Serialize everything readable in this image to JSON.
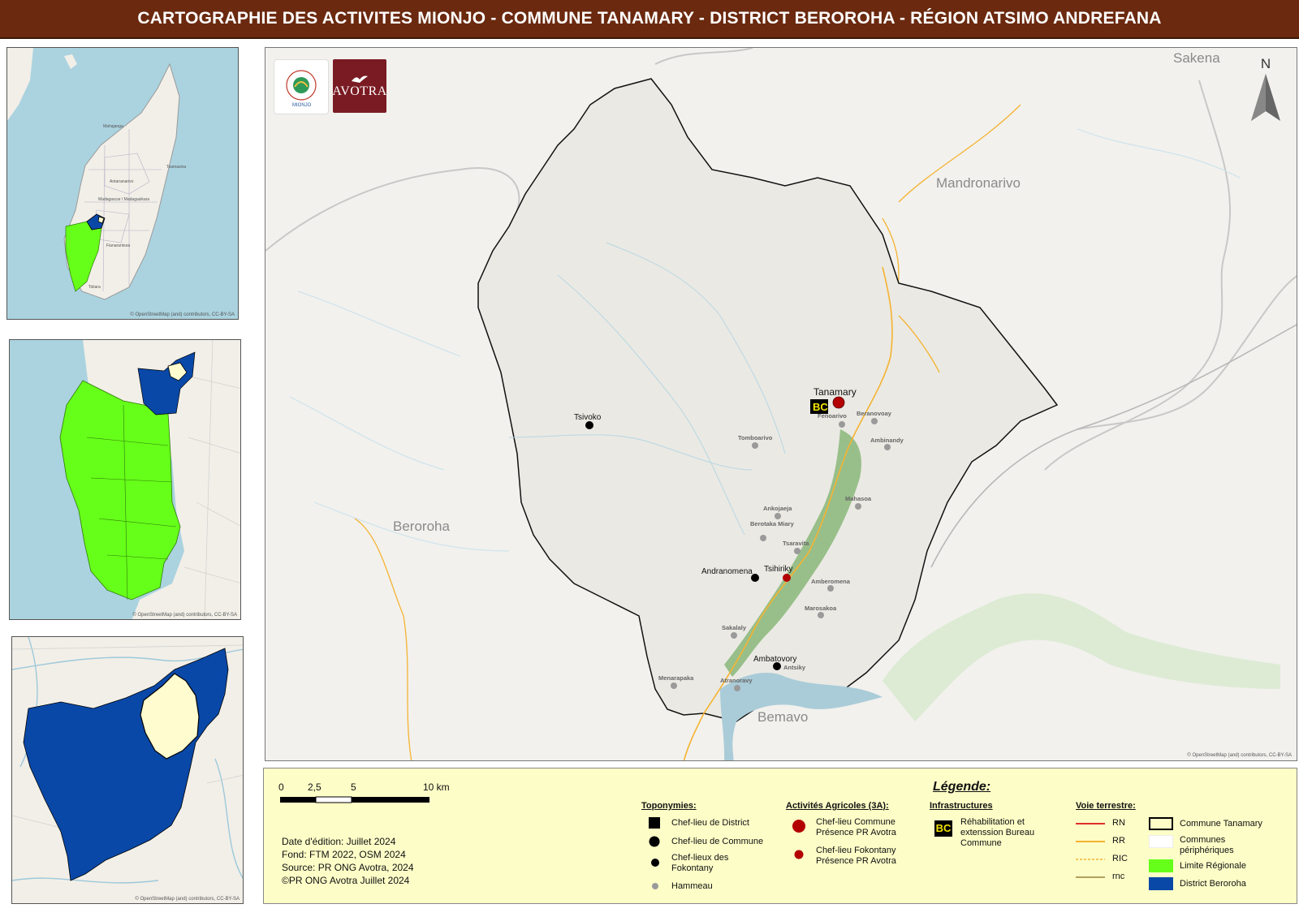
{
  "title": "CARTOGRAPHIE DES ACTIVITES MIONJO -  COMMUNE TANAMARY - DISTRICT BEROROHA - RÉGION ATSIMO ANDREFANA",
  "colors": {
    "title_bg": "#6b2a0f",
    "region_green": "#66ff1a",
    "district_blue": "#0a48a8",
    "commune_fill": "#fffcd0",
    "legend_bg": "#fdfdc8",
    "activity_red": "#b30000",
    "water": "#a9ccd8",
    "land": "#f1f0ec",
    "road_rr": "#f5b332",
    "road_rn": "#e0302b",
    "vegetation": "#8fba7e"
  },
  "inset_credit": "© OpenStreetMap (and) contributors, CC-BY-SA",
  "inset1": {
    "labels": [
      "Mahajanga",
      "Madagascar / Madagasikara",
      "Toamasina",
      "Antananarivo",
      "Fianarantsoa",
      "Toliara"
    ]
  },
  "logos": {
    "mionjo": "MIONJO",
    "avotra": "AVOTRA"
  },
  "north": "N",
  "main_map": {
    "commune_labels": {
      "sakena": "Sakena",
      "mandronarivo": "Mandronarivo",
      "beroroha": "Beroroha",
      "bemavo": "Bemavo"
    },
    "places": {
      "tanamary": "Tanamary",
      "tsivoko": "Tsivoko",
      "andranomena": "Andranomena",
      "tsihiriky": "Tsihiriky",
      "ambatovory": "Ambatovory",
      "fenoarivo": "Fenoarivo",
      "beranovoay": "Beranovoay",
      "ambinandy": "Ambinandy",
      "tomboarivo": "Tomboarivo",
      "mahasoa": "Mahasoa",
      "ankojaeja": "Ankojaeja",
      "berotaka_miary": "Berotaka Miary",
      "tsaravita": "Tsaravita",
      "amberomena": "Amberomena",
      "marosakoa": "Marosakoa",
      "sakalaly": "Sakalaly",
      "menarapaka": "Menarapaka",
      "atranoravy": "Atranoravy",
      "antsiky": "Antsiky"
    },
    "bc_badge": "BC",
    "credit": "© OpenStreetMap (and) contributors, CC-BY-SA"
  },
  "legend": {
    "title": "Légende:",
    "scale": {
      "labels": [
        "0",
        "2,5",
        "5",
        "10 km"
      ]
    },
    "edition": "Date d'édition: Juillet 2024",
    "fond": "Fond: FTM 2022, OSM 2024",
    "source": "Source: PR ONG Avotra, 2024",
    "copyright": "©PR ONG Avotra Juillet 2024",
    "toponymies": {
      "heading": "Toponymies:",
      "items": [
        "Chef-lieu de District",
        "Chef-lieu de Commune",
        "Chef-lieux des Fokontany",
        "Hammeau"
      ]
    },
    "activites": {
      "heading": "Activités Agricoles (3A):",
      "items": [
        "Chef-lieu Commune Présence PR Avotra",
        "Chef-lieu Fokontany Présence PR Avotra"
      ]
    },
    "infrastructures": {
      "heading": "Infrastructures",
      "badge": "BC",
      "item": "Réhabilitation et extenssion Bureau Commune"
    },
    "voie": {
      "heading": "Voie terrestre:",
      "items": [
        "RN",
        "RR",
        "RIC",
        "rnc"
      ]
    },
    "limits": {
      "items": [
        "Commune Tanamary",
        "Communes périphériques",
        "Limite Régionale",
        "District Beroroha"
      ]
    }
  }
}
